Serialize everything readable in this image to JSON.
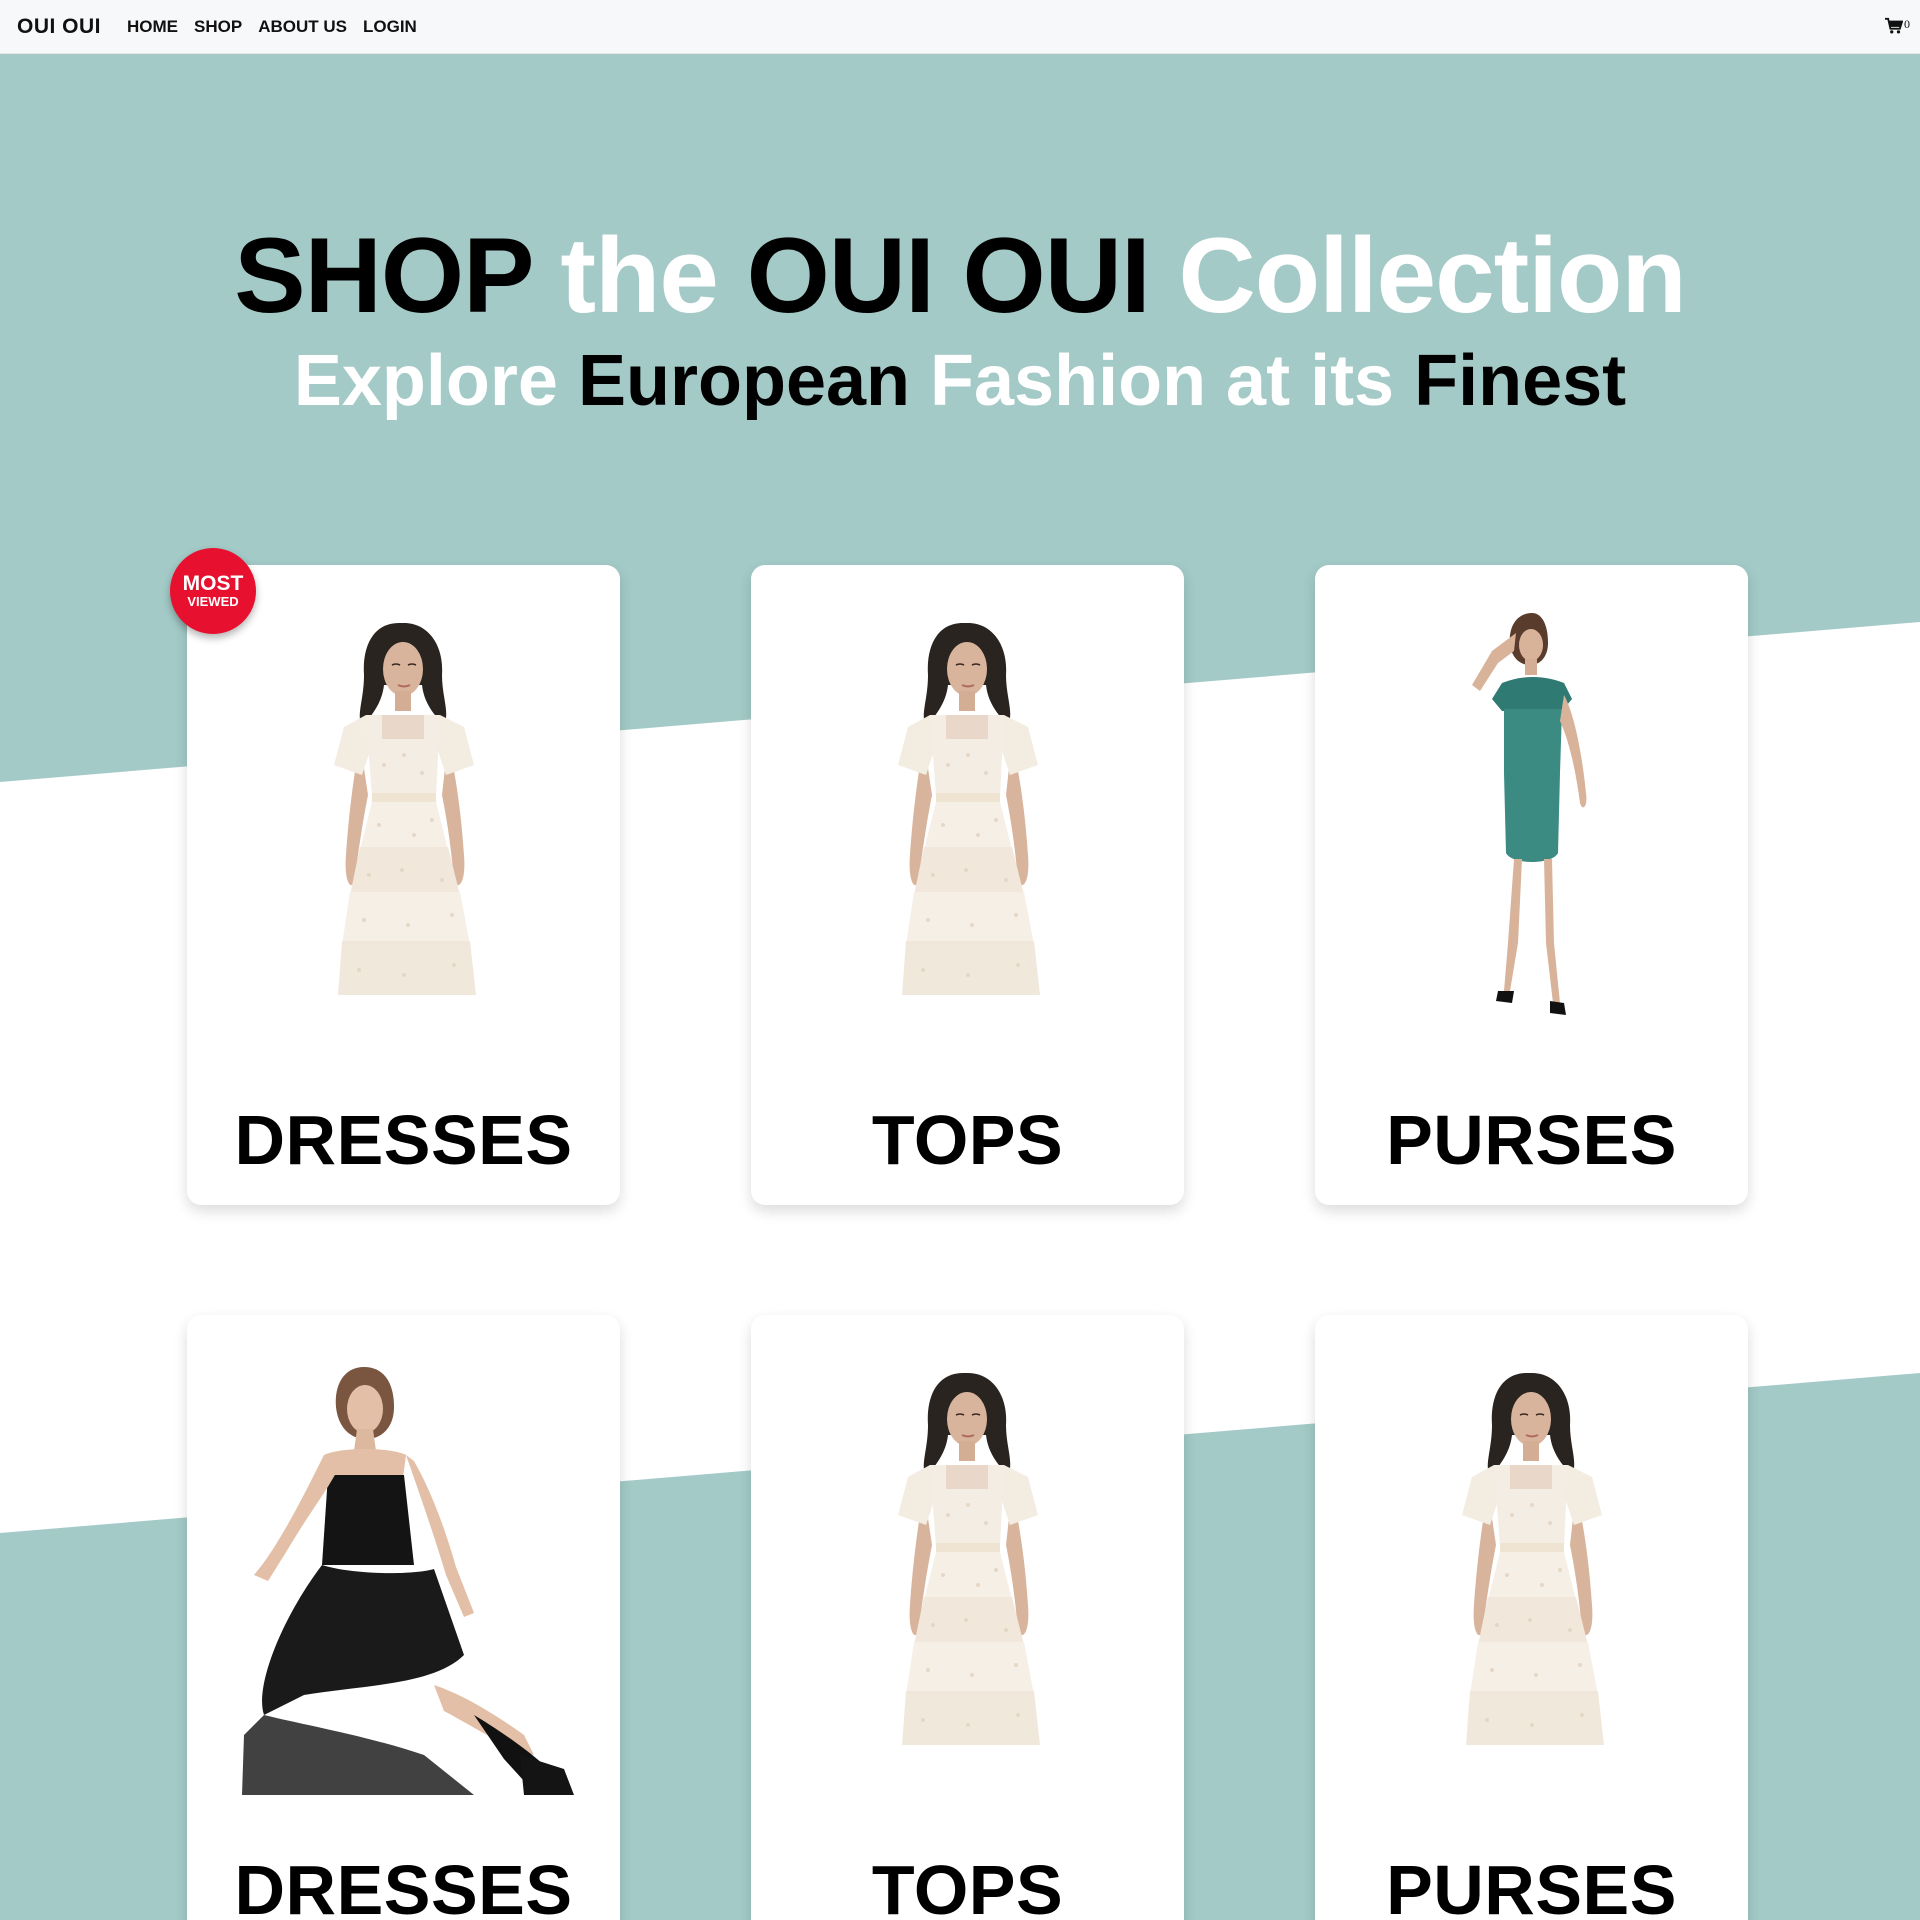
{
  "nav": {
    "brand": "OUI OUI",
    "links": [
      "HOME",
      "SHOP",
      "ABOUT US",
      "LOGIN"
    ],
    "cart_count": "0"
  },
  "hero": {
    "headline": [
      "SHOP",
      "the",
      "OUI OUI",
      "Collection"
    ],
    "subline": [
      "Explore",
      "European",
      "Fashion at its",
      "Finest"
    ]
  },
  "badge": {
    "top": "MOST",
    "bottom": "VIEWED"
  },
  "cards": [
    {
      "label": "DRESSES",
      "image": "cream-lace-dress-model"
    },
    {
      "label": "TOPS",
      "image": "cream-lace-dress-model"
    },
    {
      "label": "PURSES",
      "image": "teal-strapless-dress-model"
    },
    {
      "label": "DRESSES",
      "image": "black-strappy-dress-seated-model"
    },
    {
      "label": "TOPS",
      "image": "cream-lace-dress-model"
    },
    {
      "label": "PURSES",
      "image": "cream-lace-dress-model"
    }
  ],
  "colors": {
    "teal_background": "#a3cac7",
    "badge_red": "#e8102f",
    "nav_background": "#f7f8fa"
  }
}
